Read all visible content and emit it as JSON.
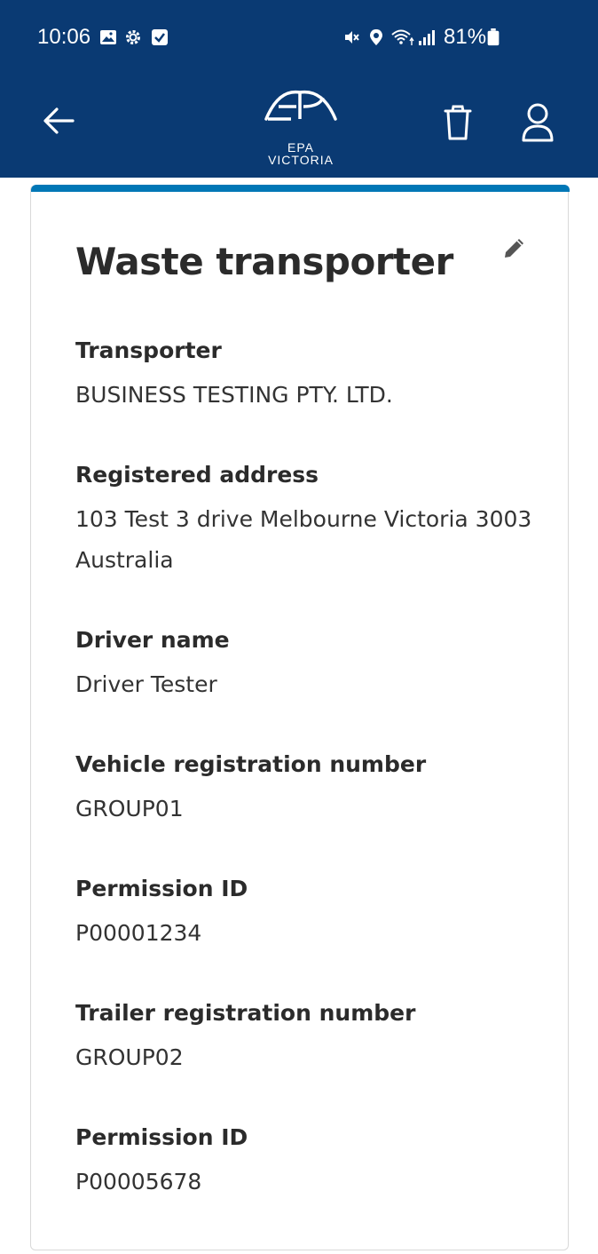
{
  "status_bar": {
    "time": "10:06",
    "battery": "81%"
  },
  "colors": {
    "header": "#0a3a73",
    "accent": "#0077b6"
  },
  "header": {
    "logo_line1": "EPA",
    "logo_line2": "VICTORIA"
  },
  "card": {
    "title": "Waste transporter",
    "fields": [
      {
        "label": "Transporter",
        "value": "BUSINESS TESTING PTY. LTD."
      },
      {
        "label": "Registered address",
        "value": "103 Test 3 drive Melbourne Victoria 3003 Australia"
      },
      {
        "label": "Driver name",
        "value": "Driver Tester"
      },
      {
        "label": "Vehicle registration number",
        "value": "GROUP01"
      },
      {
        "label": "Permission ID",
        "value": "P00001234"
      },
      {
        "label": "Trailer registration number",
        "value": "GROUP02"
      },
      {
        "label": "Permission ID",
        "value": "P00005678"
      }
    ]
  }
}
